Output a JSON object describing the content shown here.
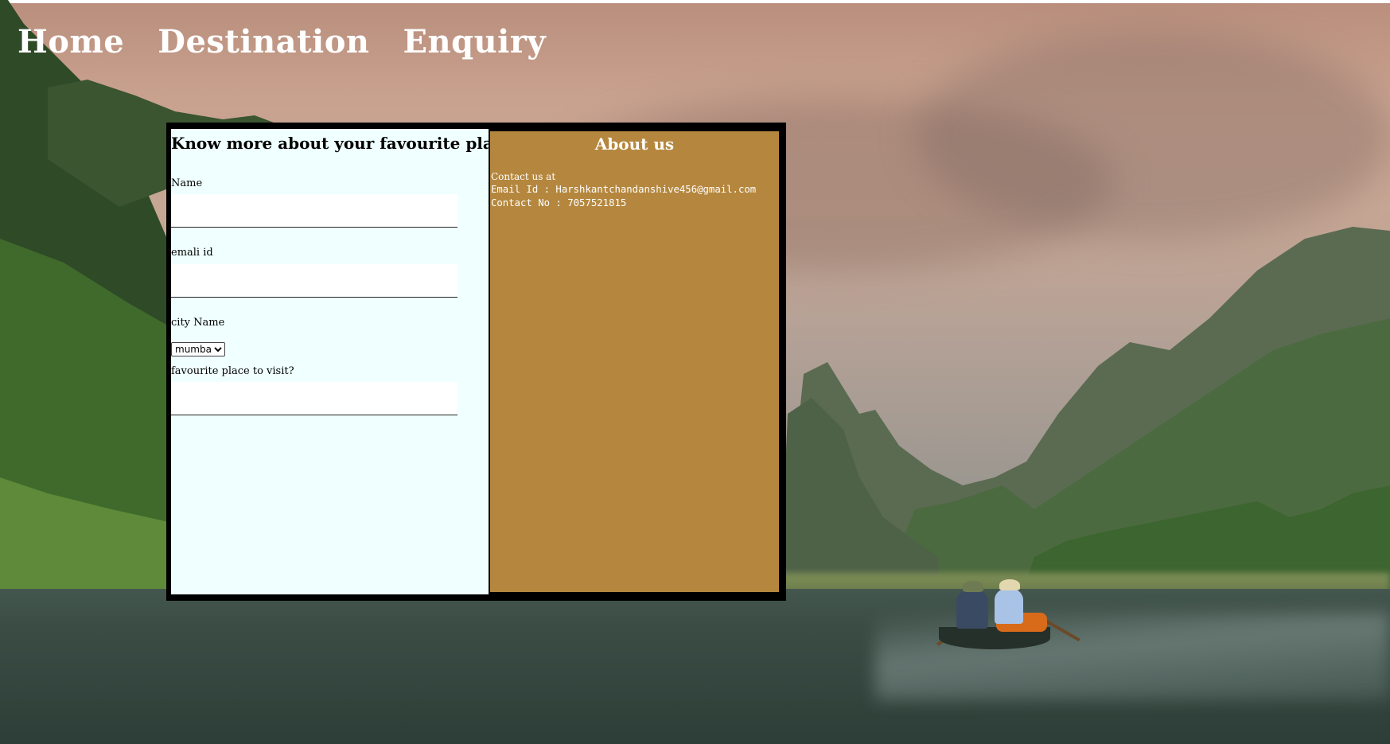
{
  "nav": {
    "home_label": "Home",
    "destination_label": "Destination",
    "enquiry_label": "Enquiry"
  },
  "form": {
    "title": "Know more about your favourite places",
    "name_label": "Name",
    "name_value": "",
    "email_label": "emali id",
    "email_value": "",
    "city_label": "city Name",
    "city_selected": "mumbai",
    "place_label": "favourite place to visit?",
    "place_value": ""
  },
  "about": {
    "title": "About us",
    "contact_at": "Contact us at",
    "email_line": "Email Id : Harshkantchandanshive456@gmail.com",
    "phone_line": "Contact No : 7057521815"
  },
  "colors": {
    "form_background": "#f0ffff",
    "about_background": "#b5873e",
    "card_border": "#000000",
    "nav_text": "#ffffff"
  }
}
